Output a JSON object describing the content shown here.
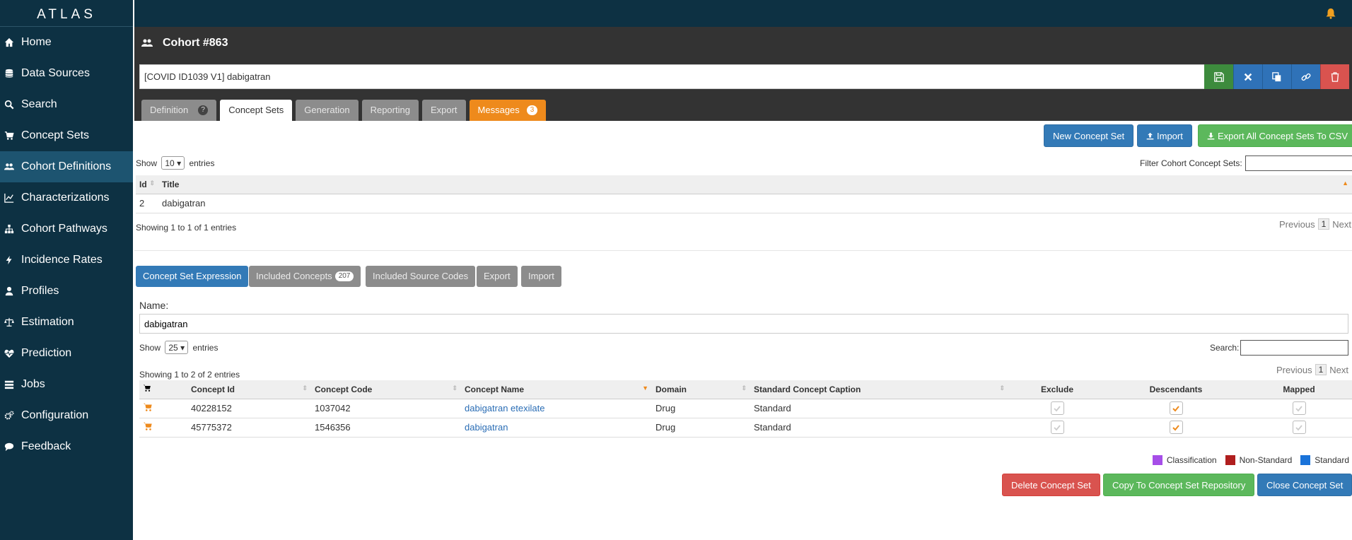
{
  "app": {
    "brand": "ATLAS"
  },
  "sidebar": {
    "items": [
      {
        "label": "Home",
        "icon": "home-icon"
      },
      {
        "label": "Data Sources",
        "icon": "database-icon"
      },
      {
        "label": "Search",
        "icon": "search-icon"
      },
      {
        "label": "Concept Sets",
        "icon": "cart-icon"
      },
      {
        "label": "Cohort Definitions",
        "icon": "users-icon",
        "active": true
      },
      {
        "label": "Characterizations",
        "icon": "chart-line-icon"
      },
      {
        "label": "Cohort Pathways",
        "icon": "sitemap-icon"
      },
      {
        "label": "Incidence Rates",
        "icon": "bolt-icon"
      },
      {
        "label": "Profiles",
        "icon": "user-icon"
      },
      {
        "label": "Estimation",
        "icon": "balance-scale-icon"
      },
      {
        "label": "Prediction",
        "icon": "heartbeat-icon"
      },
      {
        "label": "Jobs",
        "icon": "list-icon"
      },
      {
        "label": "Configuration",
        "icon": "cogs-icon"
      },
      {
        "label": "Feedback",
        "icon": "comment-icon"
      }
    ]
  },
  "header": {
    "title": "Cohort #863",
    "cohort_name": "[COVID ID1039 V1] dabigatran",
    "tabs": [
      {
        "label": "Definition"
      },
      {
        "label": "Concept Sets"
      },
      {
        "label": "Generation"
      },
      {
        "label": "Reporting"
      },
      {
        "label": "Export"
      },
      {
        "label": "Messages",
        "badge": "3"
      }
    ]
  },
  "toolbar": {
    "new_concept_set": "New Concept Set",
    "import": "Import",
    "export_all": "Export All Concept Sets To CSV"
  },
  "concept_sets_table": {
    "show_label": "Show",
    "show_value": "10",
    "entries_label": "entries",
    "filter_label": "Filter Cohort Concept Sets:",
    "columns": [
      "Id",
      "Title"
    ],
    "rows": [
      {
        "id": "2",
        "title": "dabigatran"
      }
    ],
    "info": "Showing 1 to 1 of 1 entries",
    "pager": {
      "previous": "Previous",
      "page": "1",
      "next": "Next"
    }
  },
  "expression": {
    "subtabs": [
      {
        "label": "Concept Set Expression"
      },
      {
        "label": "Included Concepts",
        "badge": "207"
      },
      {
        "label": "Included Source Codes"
      },
      {
        "label": "Export"
      },
      {
        "label": "Import"
      }
    ],
    "name_label": "Name:",
    "name_value": "dabigatran",
    "show_label": "Show",
    "show_value": "25",
    "entries_label": "entries",
    "search_label": "Search:",
    "info": "Showing 1 to 2 of 2 entries",
    "pager": {
      "previous": "Previous",
      "page": "1",
      "next": "Next"
    },
    "columns": [
      "",
      "Concept Id",
      "Concept Code",
      "Concept Name",
      "Domain",
      "Standard Concept Caption",
      "Exclude",
      "Descendants",
      "Mapped"
    ],
    "rows": [
      {
        "concept_id": "40228152",
        "concept_code": "1037042",
        "concept_name": "dabigatran etexilate",
        "domain": "Drug",
        "caption": "Standard",
        "exclude": false,
        "descendants": true,
        "mapped": false
      },
      {
        "concept_id": "45775372",
        "concept_code": "1546356",
        "concept_name": "dabigatran",
        "domain": "Drug",
        "caption": "Standard",
        "exclude": false,
        "descendants": true,
        "mapped": false
      }
    ],
    "legend": [
      {
        "label": "Classification",
        "color": "#a64ee8"
      },
      {
        "label": "Non-Standard",
        "color": "#b01e1e"
      },
      {
        "label": "Standard",
        "color": "#1a73d9"
      }
    ],
    "footer_buttons": {
      "delete": "Delete Concept Set",
      "copy": "Copy To Concept Set Repository",
      "close": "Close Concept Set"
    }
  }
}
